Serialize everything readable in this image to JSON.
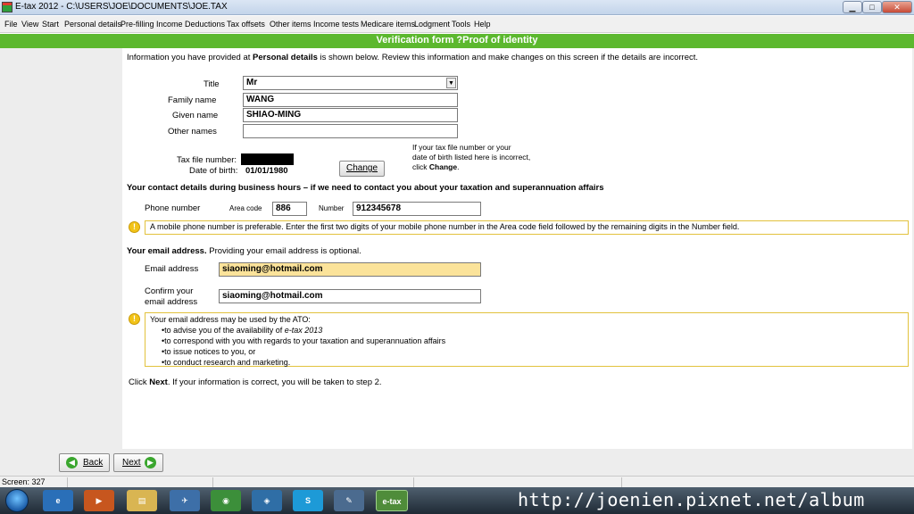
{
  "window": {
    "title": "E-tax 2012 - C:\\USERS\\JOE\\DOCUMENTS\\JOE.TAX",
    "min": "▁",
    "max": "□",
    "close": "✕"
  },
  "menu": [
    "File",
    "View",
    "Start",
    "Personal details",
    "Pre-filling",
    "Income",
    "Deductions",
    "Tax offsets",
    "Other items",
    "Income tests",
    "Medicare items",
    "Lodgment",
    "Tools",
    "Help"
  ],
  "banner": "Verification form ?Proof of identity",
  "intro": {
    "pre": "Information you have provided at ",
    "bold": "Personal details",
    "post": " is shown below. Review this information and make changes on this screen if the details are incorrect."
  },
  "personal": {
    "title_label": "Title",
    "title_value": "Mr",
    "family_label": "Family name",
    "family_value": "WANG",
    "given_label": "Given name",
    "given_value": "SHIAO-MING",
    "other_label": "Other names",
    "other_value": "",
    "tfn_label": "Tax file number:",
    "dob_label": "Date of birth:",
    "dob_value": "01/01/1980",
    "change_button": "Change",
    "change_note_1": "If your tax file number or your",
    "change_note_2": "date of birth listed here is incorrect,",
    "change_note_3_pre": "click ",
    "change_note_3_bold": "Change",
    "change_note_3_post": "."
  },
  "contact": {
    "heading": "Your contact details during business hours – if we need to contact you about your taxation and superannuation affairs",
    "phone_label": "Phone number",
    "area_label": "Area code",
    "area_value": "886",
    "number_label": "Number",
    "number_value": "912345678",
    "mobile_note": "A mobile phone number is preferable. Enter the first two digits of your mobile phone number in the Area code field followed by the remaining digits in the Number field."
  },
  "email": {
    "heading_bold": "Your email address.",
    "heading_rest": " Providing your email address is optional.",
    "email_label": "Email address",
    "email_value": "siaoming@hotmail.com",
    "confirm_label_1": "Confirm your",
    "confirm_label_2": "email address",
    "confirm_value": "siaoming@hotmail.com",
    "note_title": "Your email address may be used by the ATO:",
    "note_items": [
      "•to advise you of the availability of ",
      "•to correspond with you with regards to your taxation and superannuation affairs",
      "•to issue notices to you, or",
      "•to conduct research and marketing."
    ],
    "note_item1_italic": "e-tax 2013"
  },
  "footer_text": {
    "pre": "Click ",
    "bold": "Next",
    "post": ". If your information is correct, you will be taken to step 2."
  },
  "nav": {
    "back": "Back",
    "next": "Next"
  },
  "status": {
    "screen": "Screen: 327"
  },
  "taskbar": {
    "etax_label": "e-tax",
    "watermark": "http://joenien.pixnet.net/album"
  },
  "icons": [
    "app-icon",
    "dropdown-arrow-icon",
    "warning-icon",
    "back-arrow-icon",
    "next-arrow-icon",
    "start-orb-icon"
  ]
}
